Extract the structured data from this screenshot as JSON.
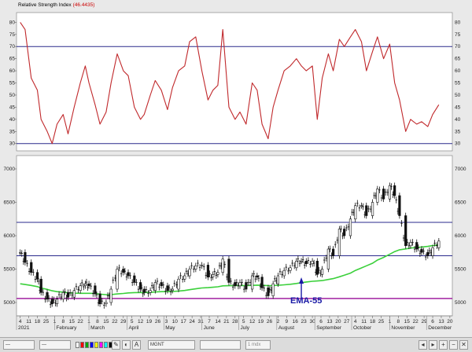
{
  "chart_data": [
    {
      "type": "line",
      "title": "Relative Strength Index",
      "title_value": "(46.4435)",
      "ylim": [
        27,
        84
      ],
      "yticks": [
        30,
        35,
        40,
        45,
        50,
        55,
        60,
        65,
        70,
        75,
        80
      ],
      "reference_lines": [
        {
          "value": 70,
          "color": "#2a2a8c"
        },
        {
          "value": 30,
          "color": "#2a2a8c"
        }
      ],
      "series": [
        {
          "color": "#c0282b",
          "x_dates": [
            "2021-01-04",
            "2021-01-08",
            "2021-01-13",
            "2021-01-18",
            "2021-01-21",
            "2021-01-26",
            "2021-01-30",
            "2021-02-03",
            "2021-02-08",
            "2021-02-12",
            "2021-02-17",
            "2021-02-22",
            "2021-02-26",
            "2021-03-01",
            "2021-03-06",
            "2021-03-10",
            "2021-03-15",
            "2021-03-19",
            "2021-03-24",
            "2021-03-29",
            "2021-04-02",
            "2021-04-07",
            "2021-04-12",
            "2021-04-15",
            "2021-04-20",
            "2021-04-24",
            "2021-04-29",
            "2021-05-04",
            "2021-05-08",
            "2021-05-13",
            "2021-05-18",
            "2021-05-22",
            "2021-05-27",
            "2021-06-01",
            "2021-06-06",
            "2021-06-10",
            "2021-06-14",
            "2021-06-18",
            "2021-06-23",
            "2021-06-28",
            "2021-07-02",
            "2021-07-07",
            "2021-07-12",
            "2021-07-16",
            "2021-07-20",
            "2021-07-25",
            "2021-07-29",
            "2021-08-02",
            "2021-08-07",
            "2021-08-12",
            "2021-08-17",
            "2021-08-21",
            "2021-08-25",
            "2021-08-30",
            "2021-09-03",
            "2021-09-07",
            "2021-09-12",
            "2021-09-16",
            "2021-09-21",
            "2021-09-25",
            "2021-09-30",
            "2021-10-04",
            "2021-10-09",
            "2021-10-13",
            "2021-10-18",
            "2021-10-22",
            "2021-10-27",
            "2021-11-01",
            "2021-11-05",
            "2021-11-09",
            "2021-11-14",
            "2021-11-18",
            "2021-11-23",
            "2021-11-27",
            "2021-12-02",
            "2021-12-06",
            "2021-12-11"
          ],
          "y": [
            80,
            77,
            57,
            52,
            40,
            35,
            30,
            38,
            42,
            34,
            45,
            55,
            62,
            55,
            46,
            38,
            43,
            55,
            67,
            60,
            58,
            45,
            40,
            42,
            50,
            56,
            52,
            44,
            53,
            60,
            62,
            72,
            74,
            60,
            48,
            52,
            54,
            77,
            45,
            40,
            43,
            38,
            55,
            52,
            38,
            32,
            45,
            52,
            60,
            62,
            65,
            62,
            60,
            62,
            40,
            57,
            67,
            60,
            73,
            70,
            74,
            77,
            72,
            60,
            68,
            74,
            65,
            71,
            55,
            48,
            35,
            40,
            38,
            39,
            37,
            42,
            46
          ]
        }
      ]
    },
    {
      "type": "candlestick",
      "ylim": [
        4800,
        7200
      ],
      "yticks": [
        5000,
        5500,
        6000,
        6500,
        7000
      ],
      "reference_lines": [
        {
          "value": 6200,
          "color": "#2a2a8c"
        },
        {
          "value": 5700,
          "color": "#2a2a8c"
        },
        {
          "value": 5060,
          "color": "#a020a0"
        }
      ],
      "x_dates": [
        "2021-01-04",
        "2021-01-08",
        "2021-01-13",
        "2021-01-18",
        "2021-01-21",
        "2021-01-26",
        "2021-01-30",
        "2021-02-03",
        "2021-02-08",
        "2021-02-12",
        "2021-02-17",
        "2021-02-22",
        "2021-02-26",
        "2021-03-01",
        "2021-03-06",
        "2021-03-10",
        "2021-03-15",
        "2021-03-19",
        "2021-03-24",
        "2021-03-29",
        "2021-04-02",
        "2021-04-07",
        "2021-04-12",
        "2021-04-15",
        "2021-04-20",
        "2021-04-24",
        "2021-04-29",
        "2021-05-04",
        "2021-05-08",
        "2021-05-13",
        "2021-05-18",
        "2021-05-22",
        "2021-05-27",
        "2021-06-01",
        "2021-06-06",
        "2021-06-10",
        "2021-06-14",
        "2021-06-18",
        "2021-06-23",
        "2021-06-28",
        "2021-07-02",
        "2021-07-07",
        "2021-07-12",
        "2021-07-16",
        "2021-07-20",
        "2021-07-25",
        "2021-07-29",
        "2021-08-02",
        "2021-08-07",
        "2021-08-12",
        "2021-08-17",
        "2021-08-21",
        "2021-08-25",
        "2021-08-30",
        "2021-09-03",
        "2021-09-07",
        "2021-09-12",
        "2021-09-16",
        "2021-09-21",
        "2021-09-25",
        "2021-09-30",
        "2021-10-04",
        "2021-10-09",
        "2021-10-13",
        "2021-10-18",
        "2021-10-22",
        "2021-10-27",
        "2021-11-01",
        "2021-11-05",
        "2021-11-09",
        "2021-11-14",
        "2021-11-18",
        "2021-11-23",
        "2021-11-27",
        "2021-12-02",
        "2021-12-06",
        "2021-12-11"
      ],
      "close": [
        5750,
        5600,
        5450,
        5350,
        5150,
        5050,
        4980,
        5050,
        5150,
        5080,
        5180,
        5250,
        5280,
        5250,
        5130,
        4980,
        5000,
        5200,
        5500,
        5450,
        5400,
        5300,
        5200,
        5150,
        5180,
        5300,
        5250,
        5180,
        5200,
        5350,
        5400,
        5500,
        5550,
        5560,
        5380,
        5420,
        5450,
        5650,
        5300,
        5250,
        5300,
        5200,
        5400,
        5380,
        5220,
        5100,
        5280,
        5400,
        5480,
        5520,
        5620,
        5620,
        5580,
        5620,
        5420,
        5500,
        5800,
        5700,
        6100,
        6000,
        6250,
        6450,
        6450,
        6300,
        6500,
        6700,
        6550,
        6750,
        6600,
        6300,
        5850,
        5900,
        5800,
        5750,
        5700,
        5820,
        5920
      ],
      "ema": {
        "label": "EMA-55",
        "color": "#3bd03b",
        "y": [
          5280,
          5270,
          5255,
          5238,
          5218,
          5197,
          5175,
          5162,
          5155,
          5145,
          5140,
          5138,
          5138,
          5138,
          5135,
          5125,
          5118,
          5118,
          5128,
          5135,
          5143,
          5148,
          5150,
          5150,
          5152,
          5158,
          5162,
          5163,
          5165,
          5172,
          5180,
          5192,
          5205,
          5218,
          5222,
          5228,
          5235,
          5250,
          5252,
          5253,
          5255,
          5253,
          5257,
          5260,
          5258,
          5252,
          5253,
          5258,
          5265,
          5273,
          5285,
          5297,
          5307,
          5318,
          5322,
          5328,
          5345,
          5358,
          5385,
          5408,
          5440,
          5480,
          5518,
          5550,
          5588,
          5635,
          5675,
          5722,
          5762,
          5790,
          5802,
          5815,
          5825,
          5830,
          5840,
          5852,
          5865
        ]
      }
    }
  ],
  "x_axis": {
    "days": [
      {
        "date": "2021-01-04",
        "label": "4"
      },
      {
        "date": "2021-01-11",
        "label": "11"
      },
      {
        "date": "2021-01-18",
        "label": "18"
      },
      {
        "date": "2021-01-25",
        "label": "25"
      },
      {
        "date": "2021-02-01",
        "label": "1"
      },
      {
        "date": "2021-02-08",
        "label": "8"
      },
      {
        "date": "2021-02-15",
        "label": "15"
      },
      {
        "date": "2021-02-22",
        "label": "22"
      },
      {
        "date": "2021-03-01",
        "label": "1"
      },
      {
        "date": "2021-03-08",
        "label": "8"
      },
      {
        "date": "2021-03-15",
        "label": "15"
      },
      {
        "date": "2021-03-22",
        "label": "22"
      },
      {
        "date": "2021-03-29",
        "label": "29"
      },
      {
        "date": "2021-04-05",
        "label": "5"
      },
      {
        "date": "2021-04-12",
        "label": "12"
      },
      {
        "date": "2021-04-19",
        "label": "19"
      },
      {
        "date": "2021-04-26",
        "label": "26"
      },
      {
        "date": "2021-05-03",
        "label": "3"
      },
      {
        "date": "2021-05-10",
        "label": "10"
      },
      {
        "date": "2021-05-17",
        "label": "17"
      },
      {
        "date": "2021-05-24",
        "label": "24"
      },
      {
        "date": "2021-05-31",
        "label": "31"
      },
      {
        "date": "2021-06-07",
        "label": "7"
      },
      {
        "date": "2021-06-14",
        "label": "14"
      },
      {
        "date": "2021-06-21",
        "label": "21"
      },
      {
        "date": "2021-06-28",
        "label": "28"
      },
      {
        "date": "2021-07-05",
        "label": "5"
      },
      {
        "date": "2021-07-12",
        "label": "12"
      },
      {
        "date": "2021-07-19",
        "label": "19"
      },
      {
        "date": "2021-07-26",
        "label": "26"
      },
      {
        "date": "2021-08-02",
        "label": "2"
      },
      {
        "date": "2021-08-09",
        "label": "9"
      },
      {
        "date": "2021-08-16",
        "label": "16"
      },
      {
        "date": "2021-08-23",
        "label": "23"
      },
      {
        "date": "2021-08-30",
        "label": "30"
      },
      {
        "date": "2021-09-06",
        "label": "6"
      },
      {
        "date": "2021-09-13",
        "label": "13"
      },
      {
        "date": "2021-09-20",
        "label": "20"
      },
      {
        "date": "2021-09-27",
        "label": "27"
      },
      {
        "date": "2021-10-04",
        "label": "4"
      },
      {
        "date": "2021-10-11",
        "label": "11"
      },
      {
        "date": "2021-10-18",
        "label": "18"
      },
      {
        "date": "2021-10-25",
        "label": "25"
      },
      {
        "date": "2021-11-01",
        "label": "1"
      },
      {
        "date": "2021-11-08",
        "label": "8"
      },
      {
        "date": "2021-11-15",
        "label": "15"
      },
      {
        "date": "2021-11-22",
        "label": "22"
      },
      {
        "date": "2021-11-29",
        "label": "29"
      },
      {
        "date": "2021-12-06",
        "label": "6"
      },
      {
        "date": "2021-12-13",
        "label": "13"
      },
      {
        "date": "2021-12-20",
        "label": "20"
      }
    ],
    "months": [
      {
        "date": "2021-01-01",
        "label": "2021"
      },
      {
        "date": "2021-02-01",
        "label": "February"
      },
      {
        "date": "2021-03-01",
        "label": "March"
      },
      {
        "date": "2021-04-01",
        "label": "April"
      },
      {
        "date": "2021-05-01",
        "label": "May"
      },
      {
        "date": "2021-06-01",
        "label": "June"
      },
      {
        "date": "2021-07-01",
        "label": "July"
      },
      {
        "date": "2021-08-01",
        "label": "August"
      },
      {
        "date": "2021-09-01",
        "label": "September"
      },
      {
        "date": "2021-10-01",
        "label": "October"
      },
      {
        "date": "2021-11-01",
        "label": "November"
      },
      {
        "date": "2021-12-01",
        "label": "December"
      }
    ]
  },
  "annotation": {
    "text": "EMA-55",
    "date": "2021-08-21",
    "value": 5070,
    "color": "#1a1aa6"
  },
  "toolbar": {
    "symbol": "MGNT",
    "field_4": "1 mdx",
    "swatch_colors": [
      "#ffffff",
      "#ff0000",
      "#00aa00",
      "#0000ff",
      "#ffff00",
      "#ff00ff",
      "#00ffff",
      "#000000"
    ]
  }
}
